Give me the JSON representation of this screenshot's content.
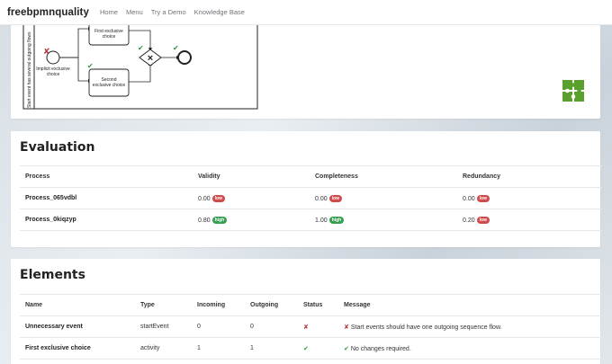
{
  "nav": {
    "brand": "freebpmnquality",
    "links": [
      "Home",
      "Menu",
      "Try a Demo",
      "Knowledge Base"
    ]
  },
  "diagram": {
    "lane_label": "Start event has several outgoing flows",
    "start_label": [
      "Implicit exclusive",
      "choice"
    ],
    "task1_label": [
      "First exclusive",
      "choice"
    ],
    "task2_label": [
      "Second",
      "exclusive choice"
    ]
  },
  "evaluation": {
    "title": "Evaluation",
    "headers": [
      "Process",
      "Validity",
      "Completeness",
      "Redundancy"
    ],
    "rows": [
      {
        "process": "Process_065vdbl",
        "validity": "0.00",
        "validity_badge": "low",
        "completeness": "0.00",
        "completeness_badge": "low",
        "redundancy": "0.00",
        "redundancy_badge": "low"
      },
      {
        "process": "Process_0kiqzyp",
        "validity": "0.80",
        "validity_badge": "high",
        "completeness": "1.00",
        "completeness_badge": "high",
        "redundancy": "0.20",
        "redundancy_badge": "low"
      }
    ]
  },
  "elements": {
    "title": "Elements",
    "headers": [
      "Name",
      "Type",
      "Incoming",
      "Outgoing",
      "Status",
      "Message"
    ],
    "rows": [
      {
        "name": "Unnecessary event",
        "type": "startEvent",
        "incoming": "0",
        "outgoing": "0",
        "status": "error",
        "message": "Start events should have one outgoing sequence flow."
      },
      {
        "name": "First exclusive choice",
        "type": "activity",
        "incoming": "1",
        "outgoing": "1",
        "status": "ok",
        "message": "No changes required."
      }
    ]
  },
  "colors": {
    "low": "#cf4a4a",
    "high": "#35a052",
    "ok": "#2e9a3d",
    "error": "#b23a3a",
    "logo": "#5aa02c"
  }
}
